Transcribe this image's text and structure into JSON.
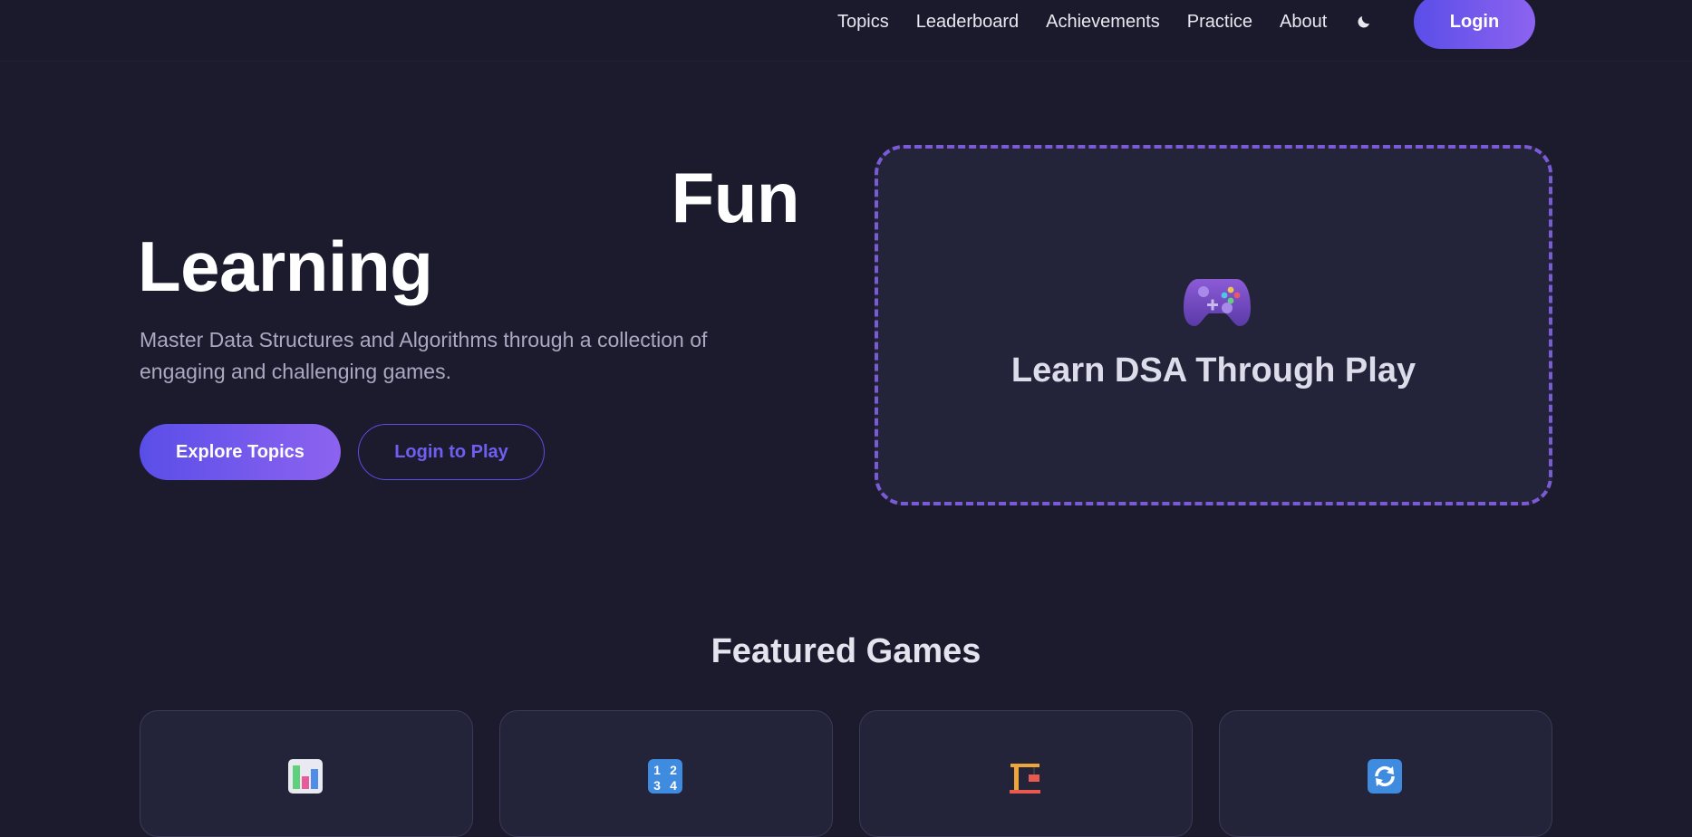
{
  "nav": {
    "items": [
      "Topics",
      "Leaderboard",
      "Achievements",
      "Practice",
      "About"
    ],
    "theme_icon": "moon-icon",
    "login_label": "Login"
  },
  "hero": {
    "title_line1": "Fun",
    "title_line2": "Learning",
    "description": "Master Data Structures and Algorithms through a collection of engaging and challenging games.",
    "explore_label": "Explore Topics",
    "login_play_label": "Login to Play",
    "box_icon": "gamepad-icon",
    "box_title": "Learn DSA Through Play"
  },
  "featured": {
    "title": "Featured Games",
    "cards": [
      {
        "icon": "bar-chart-icon"
      },
      {
        "icon": "numbers-icon"
      },
      {
        "icon": "crane-icon"
      },
      {
        "icon": "refresh-icon"
      }
    ]
  },
  "colors": {
    "background": "#1c1b2e",
    "accent_start": "#5a4ee8",
    "accent_end": "#8d63f0",
    "dashed_border": "#7b5ad6",
    "card_bg": "#232339"
  }
}
